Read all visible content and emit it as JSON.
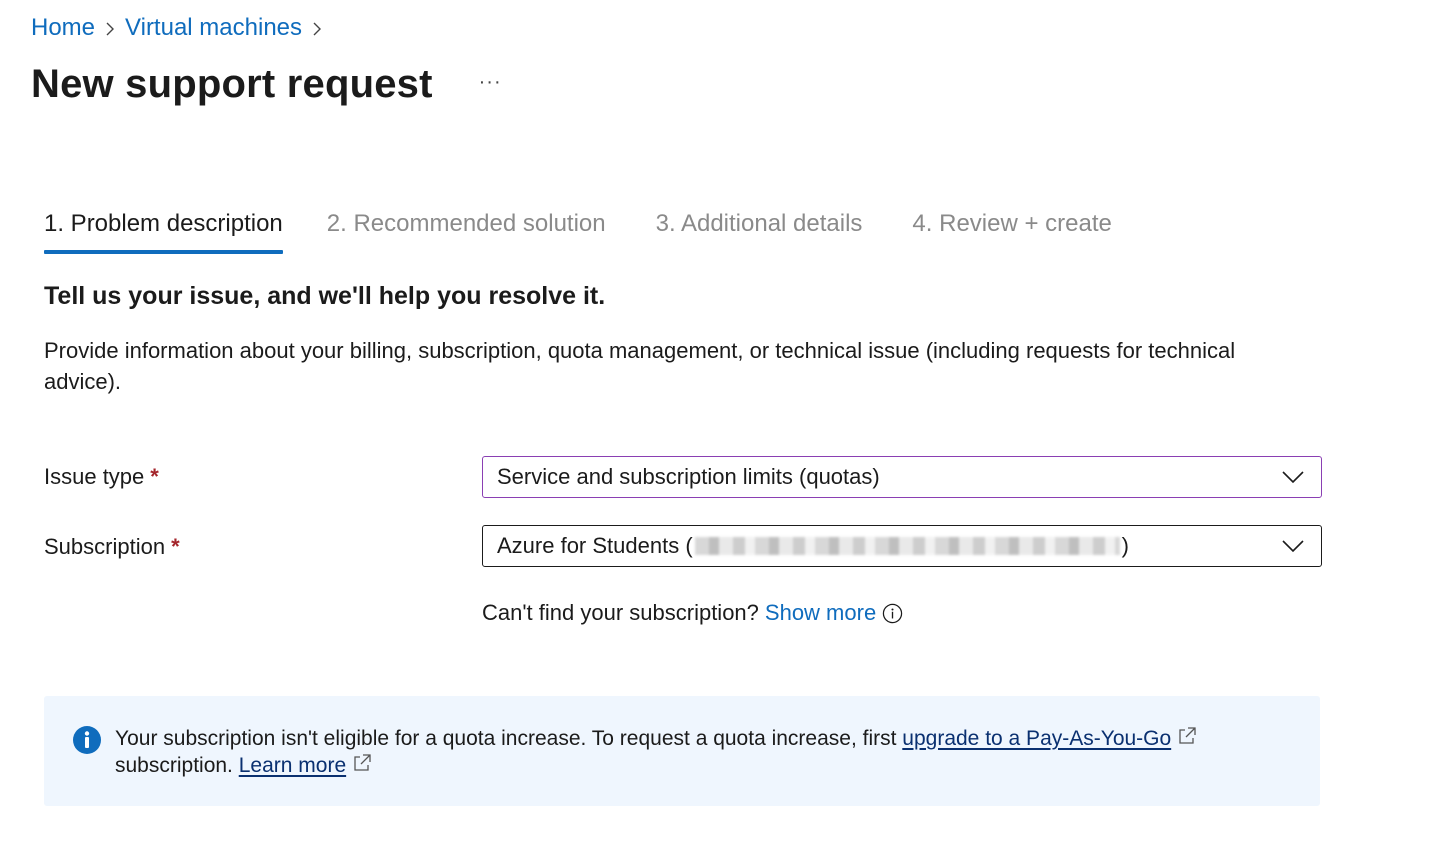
{
  "breadcrumb": {
    "items": [
      {
        "label": "Home"
      },
      {
        "label": "Virtual machines"
      }
    ]
  },
  "header": {
    "title": "New support request",
    "more_label": "···"
  },
  "tabs": [
    {
      "label": "1. Problem description",
      "active": true
    },
    {
      "label": "2. Recommended solution",
      "active": false
    },
    {
      "label": "3. Additional details",
      "active": false
    },
    {
      "label": "4. Review + create",
      "active": false
    }
  ],
  "section": {
    "heading": "Tell us your issue, and we'll help you resolve it.",
    "description": "Provide information about your billing, subscription, quota management, or technical issue (including requests for technical advice)."
  },
  "form": {
    "issue_type": {
      "label": "Issue type",
      "required_mark": "*",
      "value": "Service and subscription limits (quotas)"
    },
    "subscription": {
      "label": "Subscription",
      "required_mark": "*",
      "value_prefix": "Azure for Students (",
      "value_suffix": ")"
    },
    "hint": {
      "text": "Can't find your subscription?",
      "link": "Show more"
    }
  },
  "banner": {
    "text_1": "Your subscription isn't eligible for a quota increase. To request a quota increase, first ",
    "link_1": "upgrade to a Pay-As-You-Go",
    "text_2": "subscription. ",
    "link_2": "Learn more"
  },
  "colors": {
    "accent": "#0f6cbd",
    "focus_border": "#8a3fb3",
    "required": "#a4262c",
    "banner_bg": "#eff6fe",
    "info_icon": "#0f6cbd"
  }
}
